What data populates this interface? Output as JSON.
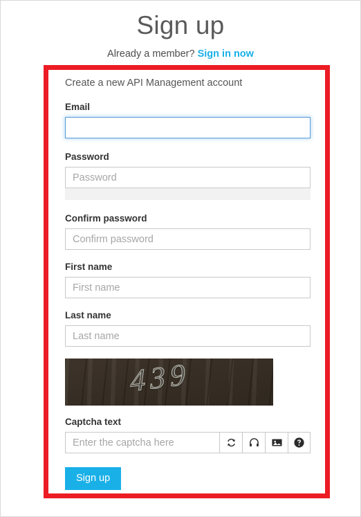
{
  "header": {
    "title": "Sign up",
    "member_prompt": "Already a member?",
    "signin_link": "Sign in now"
  },
  "form": {
    "description": "Create a new API Management account",
    "fields": [
      {
        "label": "Email",
        "placeholder": "",
        "value": "",
        "type": "email",
        "focused": true
      },
      {
        "label": "Password",
        "placeholder": "Password",
        "value": "",
        "type": "password",
        "focused": false
      },
      {
        "label": "Confirm password",
        "placeholder": "Confirm password",
        "value": "",
        "type": "password",
        "focused": false
      },
      {
        "label": "First name",
        "placeholder": "First name",
        "value": "",
        "type": "text",
        "focused": false
      },
      {
        "label": "Last name",
        "placeholder": "Last name",
        "value": "",
        "type": "text",
        "focused": false
      }
    ],
    "captcha": {
      "image_text": "439",
      "label": "Captcha text",
      "input_placeholder": "Enter the captcha here",
      "input_value": "",
      "buttons": [
        {
          "name": "refresh-icon",
          "title": "Refresh"
        },
        {
          "name": "headphones-icon",
          "title": "Audio"
        },
        {
          "name": "image-icon",
          "title": "Image"
        },
        {
          "name": "help-icon",
          "title": "Help"
        }
      ]
    },
    "submit_label": "Sign up"
  },
  "annotation": {
    "highlight_color": "#ec1c24"
  },
  "colors": {
    "accent": "#19b0e8",
    "label": "#333333",
    "placeholder": "#a6a6a6",
    "input_border": "#c8c8c8",
    "focus_border": "#5b9bd5",
    "captcha_bg": "#3a3027"
  }
}
